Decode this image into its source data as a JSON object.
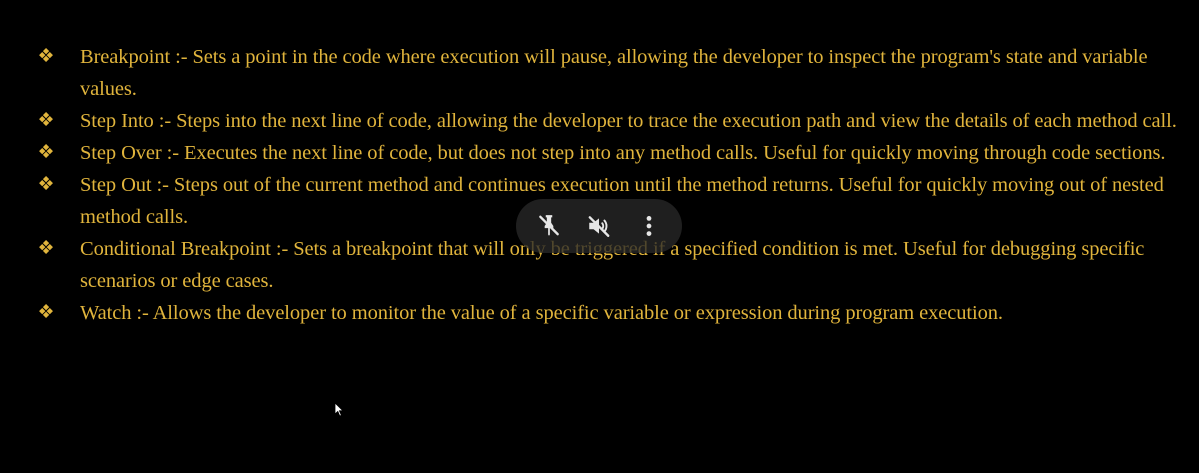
{
  "slide": {
    "bullet_glyph": "❖",
    "items": [
      {
        "text": "Breakpoint :- Sets a point in the code where execution will pause, allowing the developer to inspect the program's state and variable values."
      },
      {
        "text": "Step Into :- Steps into the next line of code, allowing the developer to trace the execution path and view the details of each method call."
      },
      {
        "text": "Step Over :- Executes the next line of code, but does not step into any method calls. Useful for quickly moving through code sections."
      },
      {
        "text": "Step Out :- Steps out of the current method and continues execution until the method returns. Useful for quickly moving out of nested method calls."
      },
      {
        "text": "Conditional Breakpoint :- Sets a breakpoint that will only be triggered if a specified condition is met. Useful for debugging specific scenarios or edge cases."
      },
      {
        "text": "Watch :- Allows the developer to monitor the value of a specific variable or expression during program execution."
      }
    ]
  },
  "overlay": {
    "buttons": [
      {
        "icon": "pin-off-icon"
      },
      {
        "icon": "volume-off-icon"
      },
      {
        "icon": "more-vertical-icon"
      }
    ]
  },
  "colors": {
    "background": "#000000",
    "text": "#e0b43c",
    "overlay_bg": "rgba(40,40,40,0.78)",
    "overlay_icon": "#e6e6e6"
  }
}
